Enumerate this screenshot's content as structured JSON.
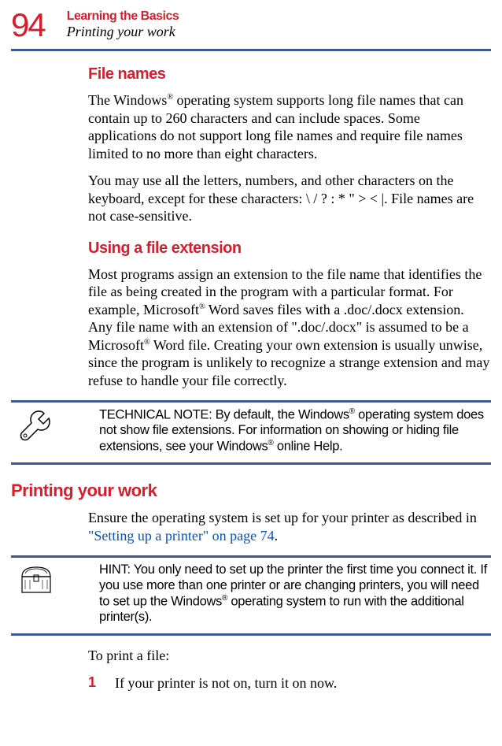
{
  "page_number": "94",
  "chapter": "Learning the Basics",
  "section_header": "Printing your work",
  "h_file_names": "File names",
  "p_file_names_1a": "The Windows",
  "reg": "®",
  "p_file_names_1b": " operating system supports long file names that can contain up to 260 characters and can include spaces. Some applications do not support long file names and require file names limited to no more than eight characters.",
  "p_file_names_2": "You may use all the letters, numbers, and other characters on the keyboard, except for these characters: \\ / ? : * \" > <  |. File names are not case-sensitive.",
  "h_file_ext": "Using a file extension",
  "p_file_ext_a": "Most programs assign an extension to the file name that identifies the file as being created in the program with a particular format. For example, Microsoft",
  "p_file_ext_b": " Word saves files with a .doc/.docx extension. Any file name with an extension of \".doc/.docx\" is assumed to be a Microsoft",
  "p_file_ext_c": " Word file. Creating your own extension is usually unwise, since the program is unlikely to recognize a strange extension and may refuse to handle your file correctly.",
  "tech_note_a": "TECHNICAL NOTE: By default, the Windows",
  "tech_note_b": " operating system does not show file extensions. For information on showing or hiding file extensions, see your Windows",
  "tech_note_c": " online Help.",
  "h_printing": "Printing your work",
  "p_printing_a": "Ensure the operating system is set up for your printer as described in ",
  "p_printing_link": "\"Setting up a printer\" on page 74",
  "p_printing_b": ".",
  "hint_a": "HINT: You only need to set up the printer the first time you connect it. If you use more than one printer or are changing printers, you will need to set up the Windows",
  "hint_b": " operating system to run with the additional printer(s).",
  "p_to_print": "To print a file:",
  "step1_num": "1",
  "step1_text": "If your printer is not on, turn it on now."
}
